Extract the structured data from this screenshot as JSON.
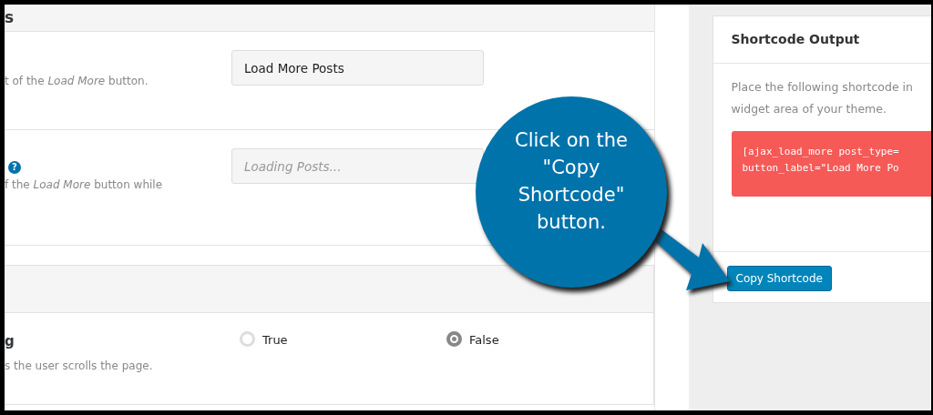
{
  "settings_panel": {
    "header": "s",
    "rows": [
      {
        "kind": "text",
        "description": "t of the *Load More* button.",
        "value": "Load More Posts"
      },
      {
        "kind": "placeholder",
        "help": "?",
        "description": "f the *Load More* button while",
        "placeholder": "Loading Posts..."
      }
    ]
  },
  "scroll_panel": {
    "title": "g",
    "description": "s the user scrolls the page.",
    "options": [
      {
        "label": "True",
        "selected": false
      },
      {
        "label": "False",
        "selected": true
      }
    ]
  },
  "shortcode_card": {
    "title": "Shortcode Output",
    "instructions": "Place the following shortcode in\nwidget area of your theme.",
    "code": "[ajax_load_more post_type=\nbutton_label=\"Load More Po",
    "button": "Copy Shortcode"
  },
  "callout": {
    "text": "Click on the \"Copy Shortcode\" button."
  }
}
